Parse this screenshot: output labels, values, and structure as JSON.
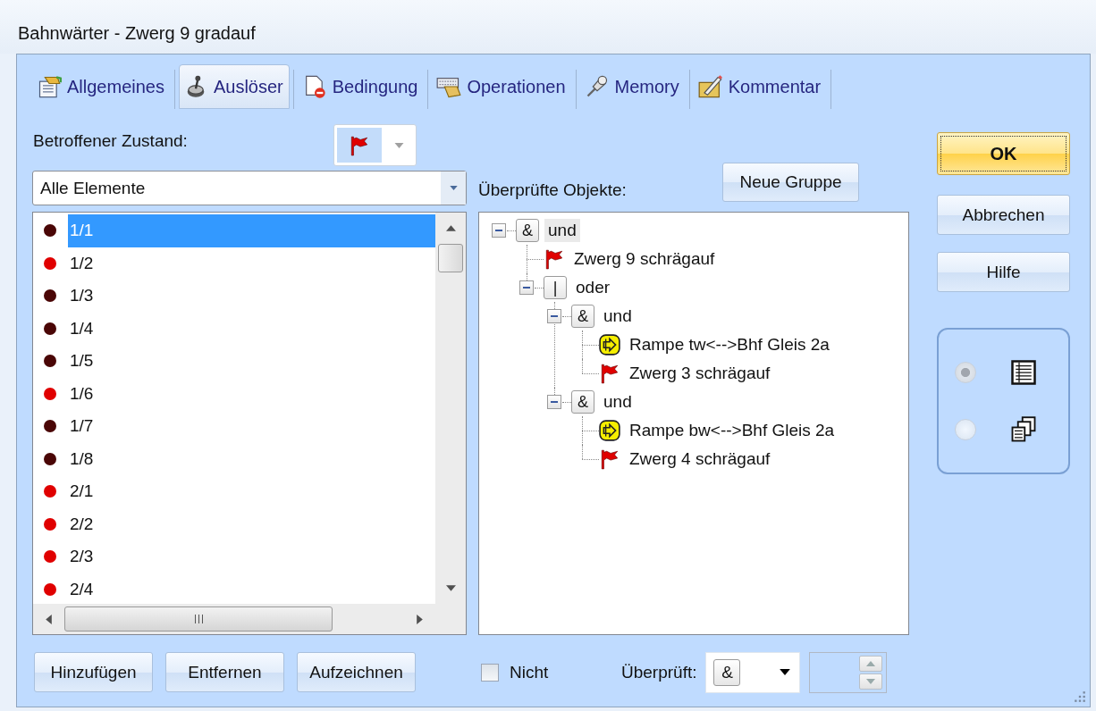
{
  "window": {
    "title": "Bahnwärter - Zwerg 9 gradauf"
  },
  "tabs": [
    {
      "label": "Allgemeines",
      "selected": false
    },
    {
      "label": "Auslöser",
      "selected": true
    },
    {
      "label": "Bedingung",
      "selected": false
    },
    {
      "label": "Operationen",
      "selected": false
    },
    {
      "label": "Memory",
      "selected": false
    },
    {
      "label": "Kommentar",
      "selected": false
    }
  ],
  "trigger": {
    "state_label": "Betroffener Zustand:",
    "filter": {
      "value": "Alle Elemente"
    },
    "elements": [
      {
        "label": "1/1",
        "color": "#4a0606",
        "selected": true
      },
      {
        "label": "1/2",
        "color": "#e00000",
        "selected": false
      },
      {
        "label": "1/3",
        "color": "#4a0606",
        "selected": false
      },
      {
        "label": "1/4",
        "color": "#4a0606",
        "selected": false
      },
      {
        "label": "1/5",
        "color": "#4a0606",
        "selected": false
      },
      {
        "label": "1/6",
        "color": "#e00000",
        "selected": false
      },
      {
        "label": "1/7",
        "color": "#4a0606",
        "selected": false
      },
      {
        "label": "1/8",
        "color": "#4a0606",
        "selected": false
      },
      {
        "label": "2/1",
        "color": "#e00000",
        "selected": false
      },
      {
        "label": "2/2",
        "color": "#e00000",
        "selected": false
      },
      {
        "label": "2/3",
        "color": "#e00000",
        "selected": false
      },
      {
        "label": "2/4",
        "color": "#e00000",
        "selected": false
      }
    ],
    "buttons": [
      "Hinzufügen",
      "Entfernen",
      "Aufzeichnen"
    ]
  },
  "checked_objects": {
    "label": "Überprüfte Objekte:",
    "new_group_button": "Neue Gruppe",
    "tree": [
      {
        "kind": "and",
        "symbol": "&",
        "label": "und",
        "expanded": true,
        "selected": true,
        "children": [
          {
            "kind": "flag",
            "label": "Zwerg 9 schrägauf",
            "selected": false
          },
          {
            "kind": "or",
            "symbol": "|",
            "label": "oder",
            "expanded": true,
            "selected": false,
            "children": [
              {
                "kind": "and",
                "symbol": "&",
                "label": "und",
                "expanded": true,
                "selected": false,
                "children": [
                  {
                    "kind": "ramp",
                    "label": "Rampe tw<-->Bhf Gleis 2a",
                    "selected": false
                  },
                  {
                    "kind": "flag",
                    "label": "Zwerg 3 schrägauf",
                    "selected": false
                  }
                ]
              },
              {
                "kind": "and",
                "symbol": "&",
                "label": "und",
                "expanded": true,
                "selected": false,
                "children": [
                  {
                    "kind": "ramp",
                    "label": "Rampe bw<-->Bhf Gleis 2a",
                    "selected": false
                  },
                  {
                    "kind": "flag",
                    "label": "Zwerg 4 schrägauf",
                    "selected": false
                  }
                ]
              }
            ]
          }
        ]
      }
    ],
    "negate": {
      "label": "Nicht",
      "checked": false
    },
    "checked_mode": {
      "label": "Überprüft:",
      "symbol": "&"
    }
  },
  "dialog_buttons": [
    {
      "label": "OK",
      "default": true
    },
    {
      "label": "Abbrechen",
      "default": false
    },
    {
      "label": "Hilfe",
      "default": false
    }
  ],
  "view_options": {
    "disabled": true,
    "options": [
      {
        "selected": true
      },
      {
        "selected": false
      }
    ]
  }
}
